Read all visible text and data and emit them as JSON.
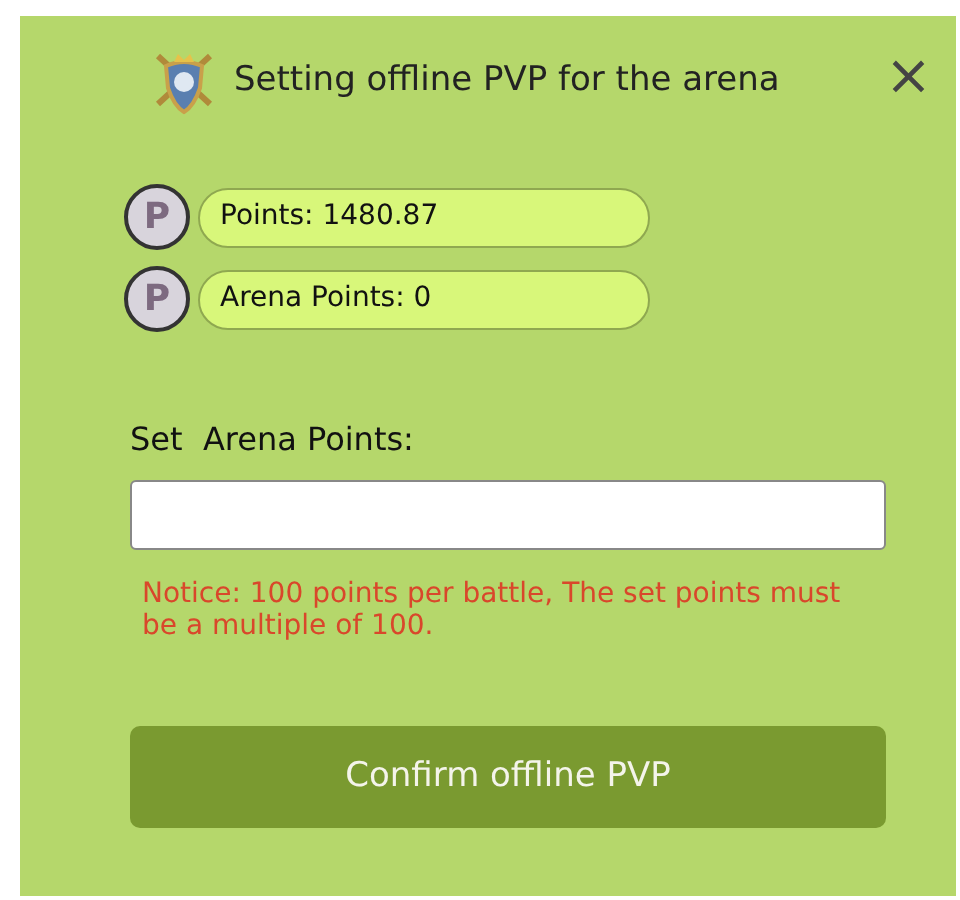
{
  "window": {
    "title": "Setting offline PVP for the arena",
    "close": "×"
  },
  "balances": [
    {
      "coin": "P",
      "text": "Points: 1480.87"
    },
    {
      "coin": "P",
      "text": "Arena Points: 0"
    }
  ],
  "form": {
    "label": "Set  Arena Points:",
    "notice": "Notice: 100 points per battle, The set points must be a multiple of 100."
  },
  "buttons": [
    "Confirm offline PVP"
  ]
}
